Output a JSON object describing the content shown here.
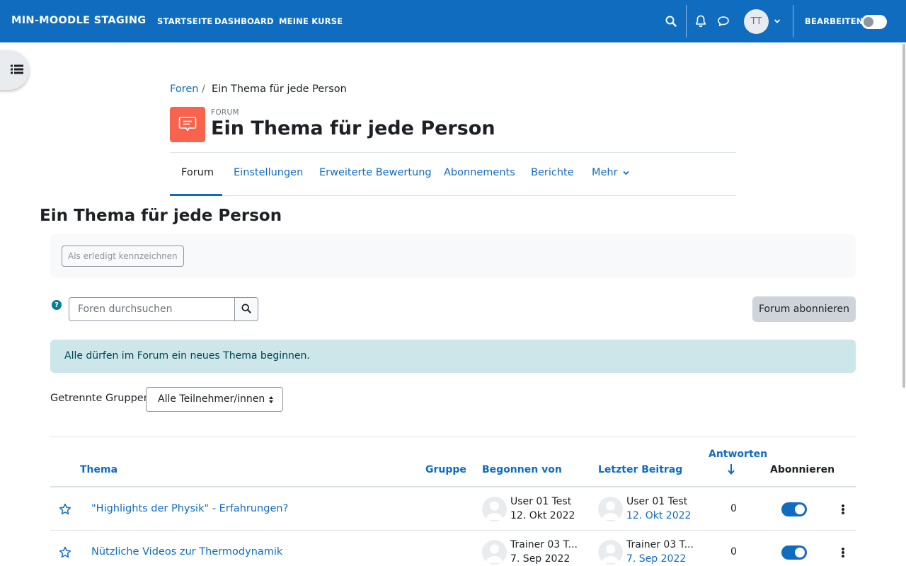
{
  "topbar": {
    "brand": "MIN-MOODLE STAGING",
    "nav": [
      "STARTSEITE",
      "DASHBOARD",
      "MEINE KURSE"
    ],
    "user_initials": "TT",
    "edit_mode_label": "BEARBEITEN",
    "edit_mode_on": false
  },
  "breadcrumb": {
    "items": [
      "Foren",
      "Ein Thema für jede Person"
    ],
    "separator": "/"
  },
  "header": {
    "module_type": "FORUM",
    "title": "Ein Thema für jede Person"
  },
  "secondary_nav": {
    "tabs": [
      "Forum",
      "Einstellungen",
      "Erweiterte Bewertung",
      "Abonnements",
      "Berichte",
      "Mehr"
    ],
    "active": "Forum"
  },
  "main": {
    "heading": "Ein Thema für jede Person",
    "completion_button": "Als erledigt kennzeichnen",
    "search_placeholder": "Foren durchsuchen",
    "subscribe_button": "Forum abonnieren",
    "info_alert": "Alle dürfen im Forum ein neues Thema beginnen.",
    "group_label": "Getrennte Gruppen",
    "group_selected": "Alle Teilnehmer/innen"
  },
  "table": {
    "headers": {
      "topic": "Thema",
      "group": "Gruppe",
      "started_by": "Begonnen von",
      "last_post": "Letzter Beitrag",
      "replies": "Antworten",
      "subscribe": "Abonnieren"
    },
    "rows": [
      {
        "topic": "\"Highlights der Physik\" - Erfahrungen?",
        "group": "",
        "started_by": "User 01 Test",
        "started_date": "12. Okt 2022",
        "last_post_by": "User 01 Test",
        "last_post_date": "12. Okt 2022",
        "replies": "0",
        "subscribed": true
      },
      {
        "topic": "Nützliche Videos zur Thermodynamik",
        "group": "",
        "started_by": "Trainer 03 T...",
        "started_date": "7. Sep 2022",
        "last_post_by": "Trainer 03 T...",
        "last_post_date": "7. Sep 2022",
        "replies": "0",
        "subscribed": true
      }
    ]
  },
  "colors": {
    "primary": "#0f6cbf",
    "forum_icon": "#f7634d",
    "info_bg": "#cce6ea",
    "info_text": "#004452"
  }
}
